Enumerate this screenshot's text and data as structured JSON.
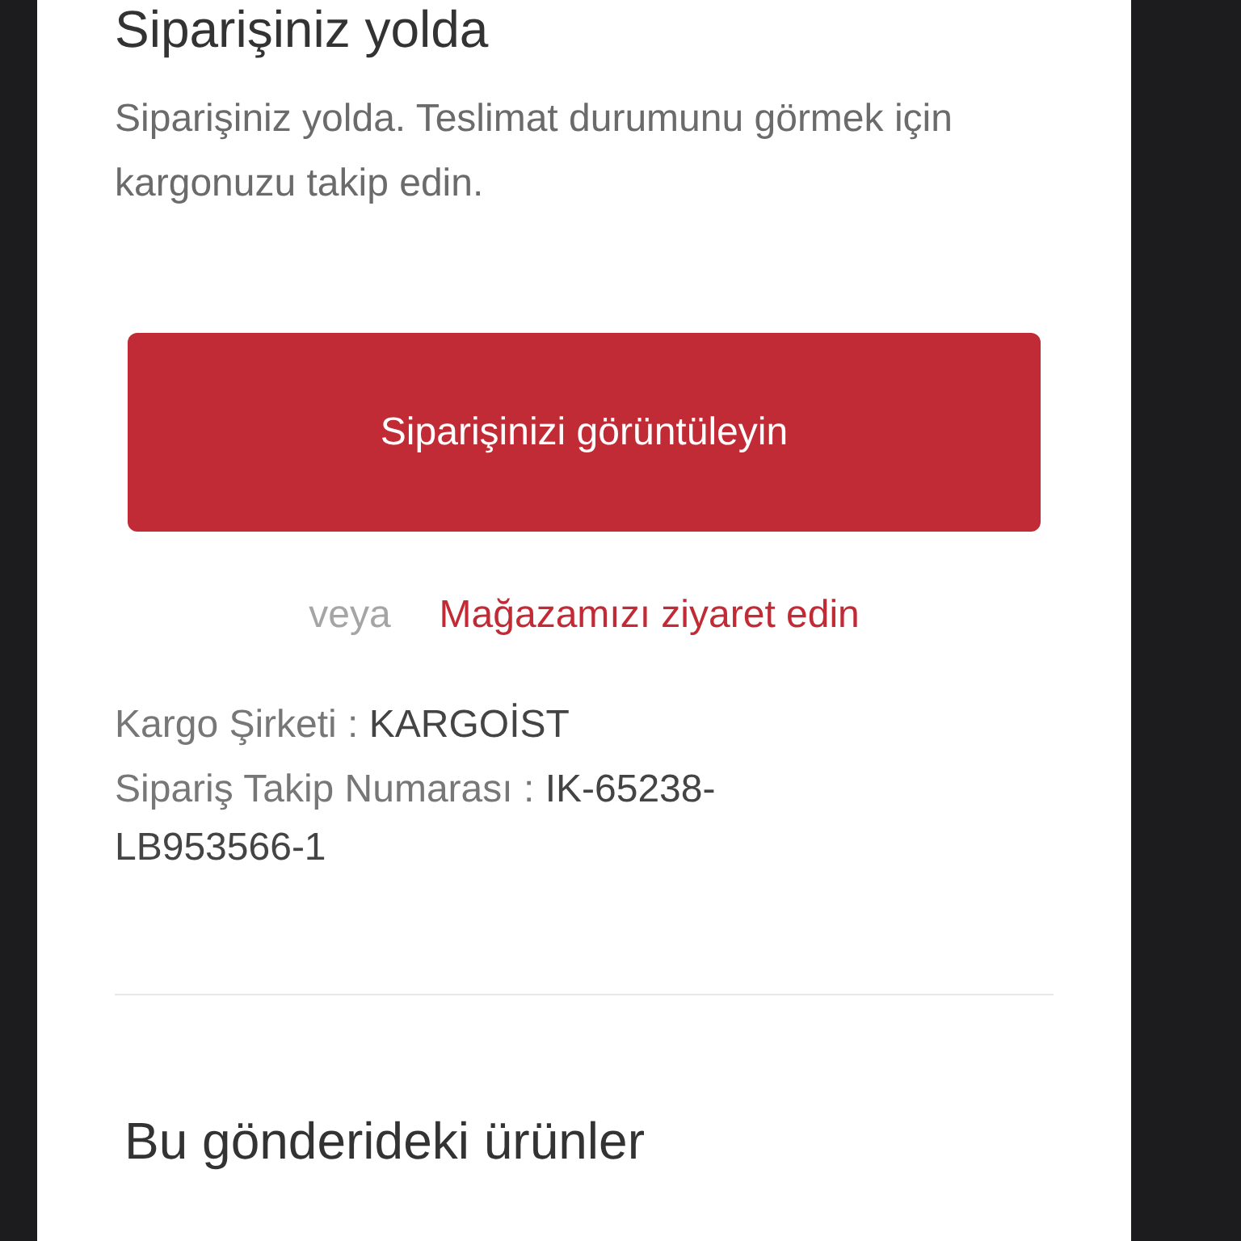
{
  "title": "Siparişiniz yolda",
  "message": "Siparişiniz yolda. Teslimat durumunu görmek için kargonuzu takip edin.",
  "primary_button": "Siparişinizi görüntüleyin",
  "or_text": "veya",
  "store_link": "Mağazamızı ziyaret edin",
  "details": [
    {
      "label": "Kargo Şirketi :",
      "value": "KARGOİST"
    },
    {
      "label": "Sipariş Takip Numarası :",
      "value": "IK-65238-LB953566-1"
    }
  ],
  "section_heading": "Bu gönderideki ürünler"
}
